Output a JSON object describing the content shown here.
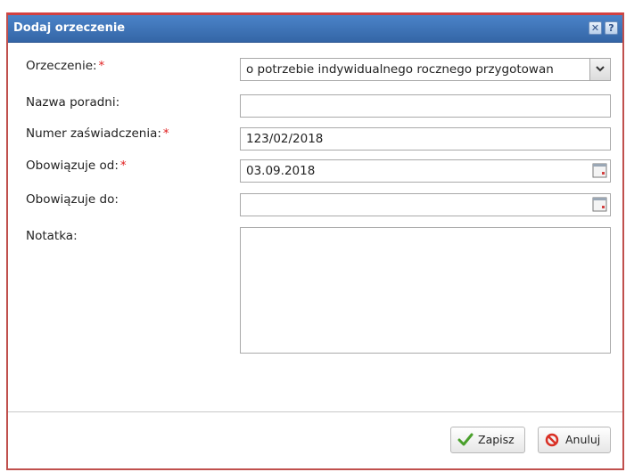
{
  "dialog": {
    "title": "Dodaj orzeczenie"
  },
  "form": {
    "orzeczenie": {
      "label": "Orzeczenie:",
      "required": "*",
      "value": "o potrzebie indywidualnego rocznego  przygotowan"
    },
    "nazwa_poradni": {
      "label": "Nazwa poradni:",
      "value": ""
    },
    "numer_zaswiadczenia": {
      "label": "Numer zaświadczenia:",
      "required": "*",
      "value": "123/02/2018"
    },
    "obowiazuje_od": {
      "label": "Obowiązuje od:",
      "required": "*",
      "value": "03.09.2018"
    },
    "obowiazuje_do": {
      "label": "Obowiązuje do:",
      "value": ""
    },
    "notatka": {
      "label": "Notatka:",
      "value": ""
    }
  },
  "buttons": {
    "save_label": "Zapisz",
    "cancel_label": "Anuluj"
  },
  "icons": {
    "close": "close-icon",
    "help": "help-icon",
    "dropdown": "chevron-down-icon",
    "calendar": "calendar-icon",
    "save": "checkmark-icon",
    "cancel": "no-entry-icon"
  },
  "colors": {
    "titlebar": "#3f77bd",
    "required": "#e02020",
    "border_accent": "#d34141"
  }
}
